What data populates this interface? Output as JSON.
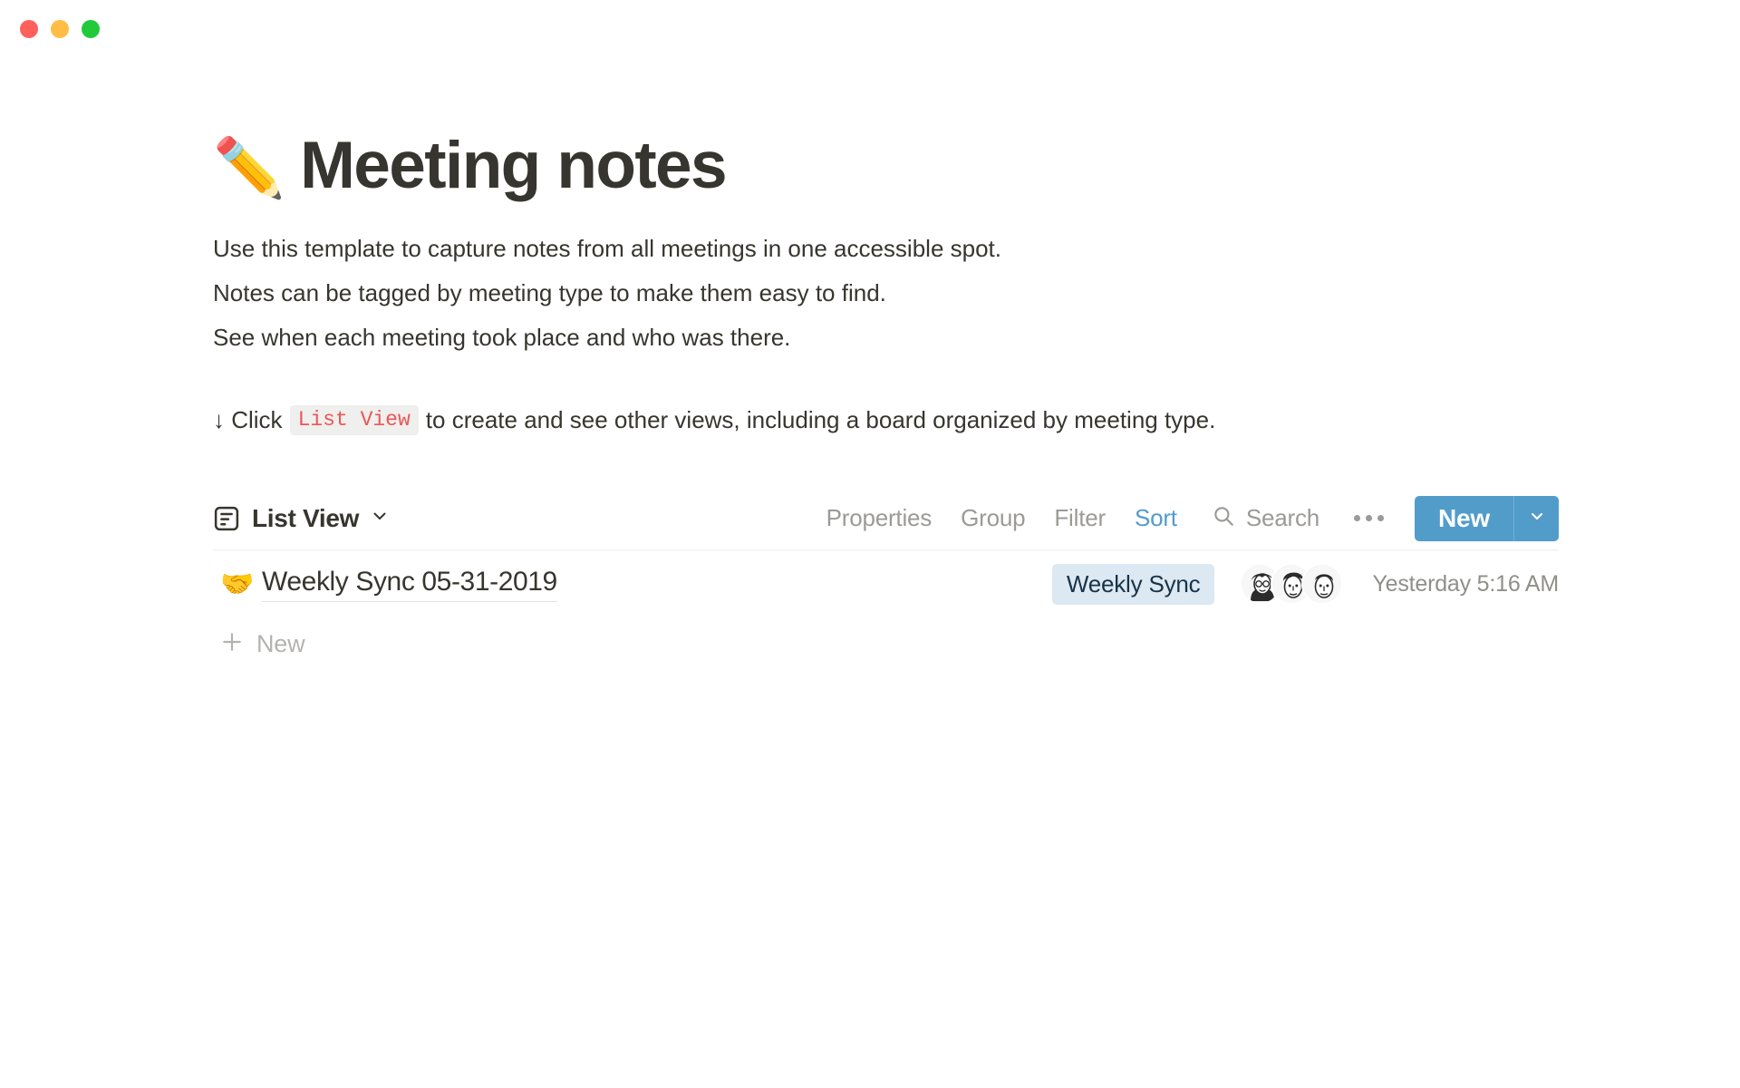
{
  "window": {
    "controls": [
      {
        "name": "close",
        "color": "#FF605C"
      },
      {
        "name": "minimize",
        "color": "#FFBD44"
      },
      {
        "name": "maximize",
        "color": "#22C93A"
      }
    ]
  },
  "page": {
    "emoji": "✏️",
    "title": "Meeting notes",
    "description_lines": [
      "Use this template to capture notes from all meetings in one accessible spot.",
      "Notes can be tagged by meeting type to make them easy to find.",
      "See when each meeting took place and who was there."
    ],
    "hint": {
      "prefix": "↓ Click",
      "code": "List View",
      "suffix": "to create and see other views, including a board organized by meeting type."
    }
  },
  "toolbar": {
    "view_icon": "list-view-icon",
    "view_label": "List View",
    "view_chevron": "chevron-down-icon",
    "buttons": [
      {
        "label": "Properties",
        "active": false
      },
      {
        "label": "Group",
        "active": false
      },
      {
        "label": "Filter",
        "active": false
      },
      {
        "label": "Sort",
        "active": true
      }
    ],
    "search_icon": "search-icon",
    "search_label": "Search",
    "more_icon": "ellipsis-icon",
    "new_label": "New",
    "new_caret_icon": "chevron-down-icon",
    "accent_color": "#529CCA",
    "active_color": "#529CCA",
    "muted_color": "#9B9A97"
  },
  "list": {
    "rows": [
      {
        "emoji": "🤝",
        "title": "Weekly Sync 05-31-2019",
        "tag": "Weekly Sync",
        "tag_bg": "#DCE8F2",
        "tag_color": "#183347",
        "avatar_count": 3,
        "timestamp": "Yesterday 5:16 AM"
      }
    ],
    "new_row": {
      "icon": "plus-icon",
      "label": "New"
    }
  }
}
